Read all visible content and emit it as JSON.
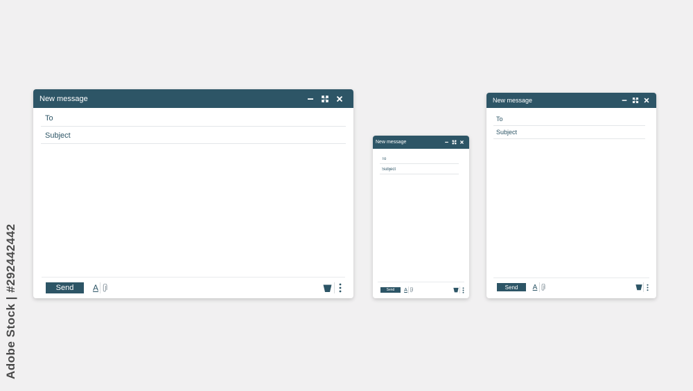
{
  "theme": {
    "accent": "#2d5566",
    "background": "#f1f0f1",
    "window": "#ffffff"
  },
  "windows": [
    {
      "id": "large",
      "title": "New message",
      "to_placeholder": "To",
      "subject_placeholder": "Subject",
      "send_label": "Send",
      "format_label": "A",
      "icons": [
        "minimize-icon",
        "expand-icon",
        "close-icon",
        "format-text-icon",
        "paperclip-icon",
        "trash-icon",
        "more-vertical-icon"
      ]
    },
    {
      "id": "small",
      "title": "New message",
      "to_placeholder": "To",
      "subject_placeholder": "Subject",
      "send_label": "Send",
      "format_label": "A",
      "icons": [
        "minimize-icon",
        "expand-icon",
        "close-icon",
        "format-text-icon",
        "paperclip-icon",
        "trash-icon",
        "more-vertical-icon"
      ]
    },
    {
      "id": "medium",
      "title": "New message",
      "to_placeholder": "To",
      "subject_placeholder": "Subject",
      "send_label": "Send",
      "format_label": "A",
      "icons": [
        "minimize-icon",
        "expand-icon",
        "close-icon",
        "format-text-icon",
        "paperclip-icon",
        "trash-icon",
        "more-vertical-icon"
      ]
    }
  ],
  "watermark": {
    "stock_id": "Adobe Stock | #292442442"
  }
}
